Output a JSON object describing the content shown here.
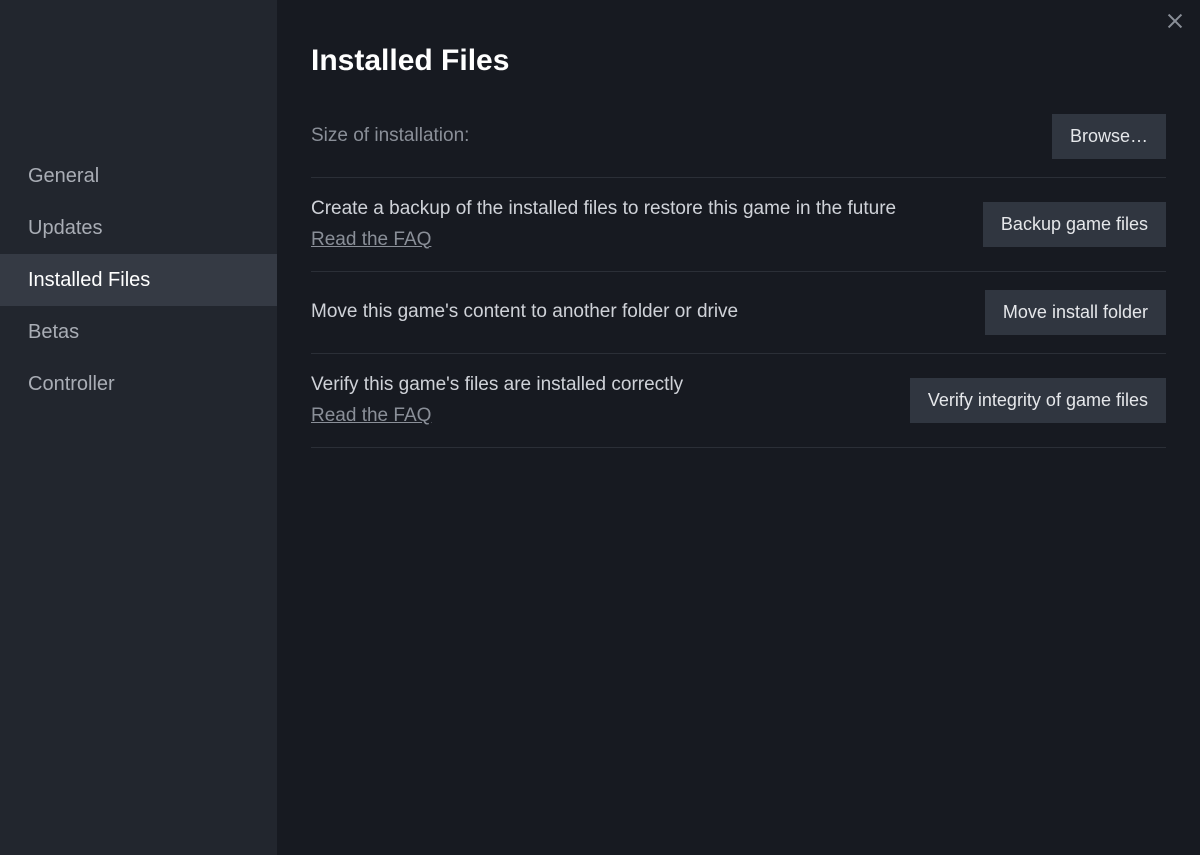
{
  "sidebar": {
    "items": [
      {
        "label": "General"
      },
      {
        "label": "Updates"
      },
      {
        "label": "Installed Files"
      },
      {
        "label": "Betas"
      },
      {
        "label": "Controller"
      }
    ],
    "active_index": 2
  },
  "page": {
    "title": "Installed Files"
  },
  "rows": {
    "size": {
      "label": "Size of installation:",
      "button": "Browse…"
    },
    "backup": {
      "desc": "Create a backup of the installed files to restore this game in the future",
      "faq": "Read the FAQ",
      "button": "Backup game files"
    },
    "move": {
      "desc": "Move this game's content to another folder or drive",
      "button": "Move install folder"
    },
    "verify": {
      "desc": "Verify this game's files are installed correctly",
      "faq": "Read the FAQ",
      "button": "Verify integrity of game files"
    }
  }
}
